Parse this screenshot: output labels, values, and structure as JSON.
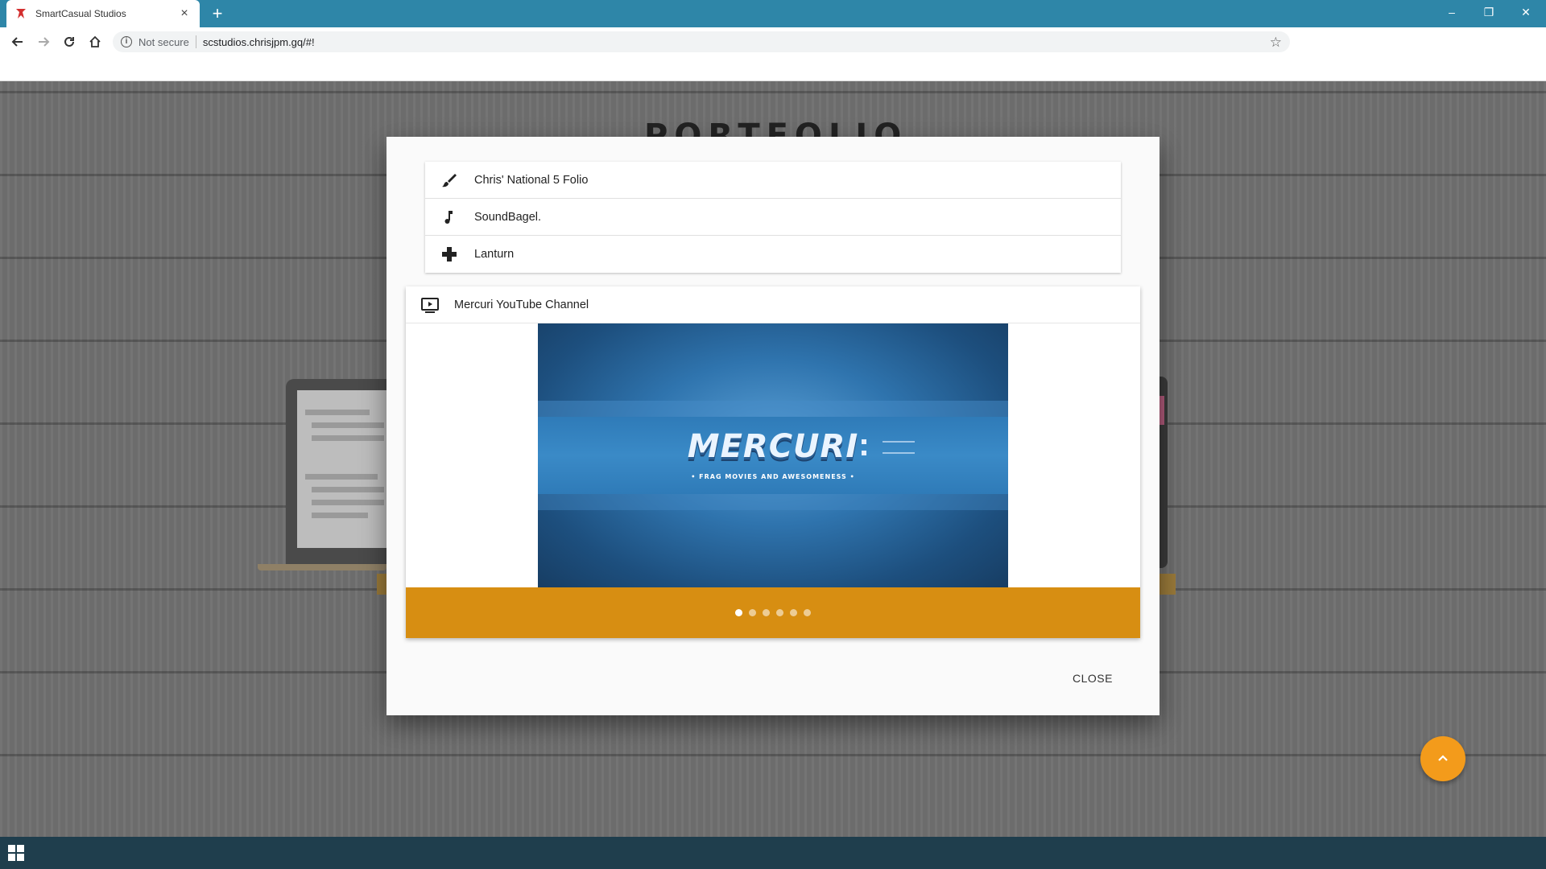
{
  "browser": {
    "tab_title": "SmartCasual Studios",
    "tab_close": "×",
    "new_tab": "+",
    "security_label": "Not secure",
    "url": "scstudios.chrisjpm.gq/#!",
    "window_controls": {
      "minimize": "–",
      "restore": "❐",
      "close": "✕"
    }
  },
  "page": {
    "heading": "PORTFOLIO"
  },
  "modal": {
    "items": [
      {
        "label": "Chris' National 5 Folio",
        "icon": "brush-icon"
      },
      {
        "label": "SoundBagel.",
        "icon": "music-note-icon"
      },
      {
        "label": "Lanturn",
        "icon": "gamepad-icon"
      }
    ],
    "card": {
      "title": "Mercuri YouTube Channel",
      "icon": "video-play-icon",
      "banner_brand": "MERCURI",
      "banner_tagline": "• FRAG MOVIES AND AWESOMENESS •",
      "slide_count": 6,
      "active_slide": 1
    },
    "close_label": "CLOSE"
  },
  "colors": {
    "chrome_bar": "#2e86a8",
    "card_footer": "#d78e12",
    "fab": "#f39b1b",
    "taskbar": "#1f3e4d"
  }
}
